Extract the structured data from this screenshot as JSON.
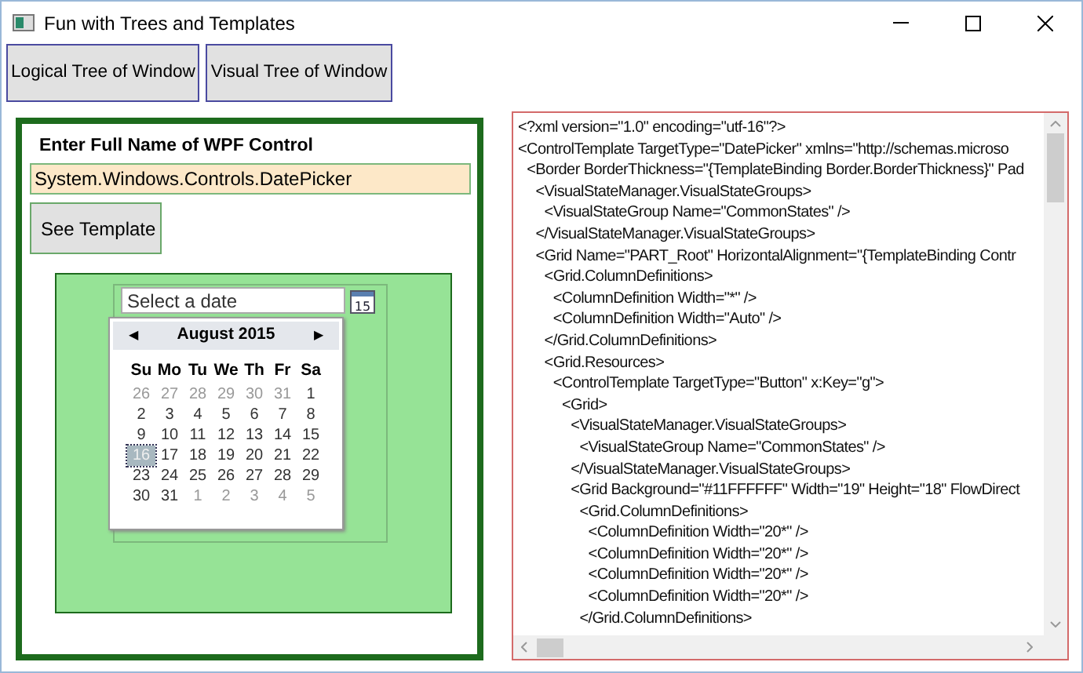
{
  "window": {
    "title": "Fun with Trees and Templates"
  },
  "top_buttons": [
    "Logical Tree of Window",
    "Visual Tree of Window"
  ],
  "control_panel": {
    "label": "Enter Full Name of WPF Control",
    "value": "System.Windows.Controls.DatePicker",
    "button": "See Template"
  },
  "date_picker": {
    "placeholder": "Select a date",
    "calendar_icon_text": "15",
    "calendar": {
      "month": "August 2015",
      "prev": "◀",
      "next": "▶",
      "weekdays": [
        "Su",
        "Mo",
        "Tu",
        "We",
        "Th",
        "Fr",
        "Sa"
      ],
      "weeks": [
        [
          {
            "day": "26",
            "in_month": false,
            "selected": false
          },
          {
            "day": "27",
            "in_month": false,
            "selected": false
          },
          {
            "day": "28",
            "in_month": false,
            "selected": false
          },
          {
            "day": "29",
            "in_month": false,
            "selected": false
          },
          {
            "day": "30",
            "in_month": false,
            "selected": false
          },
          {
            "day": "31",
            "in_month": false,
            "selected": false
          },
          {
            "day": "1",
            "in_month": true,
            "selected": false
          }
        ],
        [
          {
            "day": "2",
            "in_month": true,
            "selected": false
          },
          {
            "day": "3",
            "in_month": true,
            "selected": false
          },
          {
            "day": "4",
            "in_month": true,
            "selected": false
          },
          {
            "day": "5",
            "in_month": true,
            "selected": false
          },
          {
            "day": "6",
            "in_month": true,
            "selected": false
          },
          {
            "day": "7",
            "in_month": true,
            "selected": false
          },
          {
            "day": "8",
            "in_month": true,
            "selected": false
          }
        ],
        [
          {
            "day": "9",
            "in_month": true,
            "selected": false
          },
          {
            "day": "10",
            "in_month": true,
            "selected": false
          },
          {
            "day": "11",
            "in_month": true,
            "selected": false
          },
          {
            "day": "12",
            "in_month": true,
            "selected": false
          },
          {
            "day": "13",
            "in_month": true,
            "selected": false
          },
          {
            "day": "14",
            "in_month": true,
            "selected": false
          },
          {
            "day": "15",
            "in_month": true,
            "selected": false
          }
        ],
        [
          {
            "day": "16",
            "in_month": true,
            "selected": true
          },
          {
            "day": "17",
            "in_month": true,
            "selected": false
          },
          {
            "day": "18",
            "in_month": true,
            "selected": false
          },
          {
            "day": "19",
            "in_month": true,
            "selected": false
          },
          {
            "day": "20",
            "in_month": true,
            "selected": false
          },
          {
            "day": "21",
            "in_month": true,
            "selected": false
          },
          {
            "day": "22",
            "in_month": true,
            "selected": false
          }
        ],
        [
          {
            "day": "23",
            "in_month": true,
            "selected": false
          },
          {
            "day": "24",
            "in_month": true,
            "selected": false
          },
          {
            "day": "25",
            "in_month": true,
            "selected": false
          },
          {
            "day": "26",
            "in_month": true,
            "selected": false
          },
          {
            "day": "27",
            "in_month": true,
            "selected": false
          },
          {
            "day": "28",
            "in_month": true,
            "selected": false
          },
          {
            "day": "29",
            "in_month": true,
            "selected": false
          }
        ],
        [
          {
            "day": "30",
            "in_month": true,
            "selected": false
          },
          {
            "day": "31",
            "in_month": true,
            "selected": false
          },
          {
            "day": "1",
            "in_month": false,
            "selected": false
          },
          {
            "day": "2",
            "in_month": false,
            "selected": false
          },
          {
            "day": "3",
            "in_month": false,
            "selected": false
          },
          {
            "day": "4",
            "in_month": false,
            "selected": false
          },
          {
            "day": "5",
            "in_month": false,
            "selected": false
          }
        ]
      ]
    }
  },
  "template_xml": [
    {
      "text": "<?xml version=\"1.0\" encoding=\"utf-16\"?>"
    },
    {
      "text": "<ControlTemplate TargetType=\"DatePicker\" xmlns=\"http://schemas.microso",
      "children": [
        {
          "text": "<Border BorderThickness=\"{TemplateBinding Border.BorderThickness}\" Pad",
          "children": [
            {
              "text": "<VisualStateManager.VisualStateGroups>",
              "children": [
                {
                  "text": "<VisualStateGroup Name=\"CommonStates\" />"
                }
              ]
            },
            {
              "text": "</VisualStateManager.VisualStateGroups>"
            },
            {
              "text": "<Grid Name=\"PART_Root\" HorizontalAlignment=\"{TemplateBinding Contr",
              "children": [
                {
                  "text": "<Grid.ColumnDefinitions>",
                  "children": [
                    {
                      "text": "<ColumnDefinition Width=\"*\" />"
                    },
                    {
                      "text": "<ColumnDefinition Width=\"Auto\" />"
                    }
                  ]
                },
                {
                  "text": "</Grid.ColumnDefinitions>"
                },
                {
                  "text": "<Grid.Resources>",
                  "children": [
                    {
                      "text": "<ControlTemplate TargetType=\"Button\" x:Key=\"g\">",
                      "children": [
                        {
                          "text": "<Grid>",
                          "children": [
                            {
                              "text": "<VisualStateManager.VisualStateGroups>",
                              "children": [
                                {
                                  "text": "<VisualStateGroup Name=\"CommonStates\" />"
                                }
                              ]
                            },
                            {
                              "text": "</VisualStateManager.VisualStateGroups>"
                            },
                            {
                              "text": "<Grid Background=\"#11FFFFFF\" Width=\"19\" Height=\"18\" FlowDirect",
                              "children": [
                                {
                                  "text": "<Grid.ColumnDefinitions>",
                                  "children": [
                                    {
                                      "text": "<ColumnDefinition Width=\"20*\" />"
                                    },
                                    {
                                      "text": "<ColumnDefinition Width=\"20*\" />"
                                    },
                                    {
                                      "text": "<ColumnDefinition Width=\"20*\" />"
                                    },
                                    {
                                      "text": "<ColumnDefinition Width=\"20*\" />"
                                    }
                                  ]
                                },
                                {
                                  "text": "</Grid.ColumnDefinitions>"
                                }
                              ]
                            }
                          ]
                        }
                      ]
                    }
                  ]
                }
              ]
            }
          ]
        }
      ]
    }
  ]
}
